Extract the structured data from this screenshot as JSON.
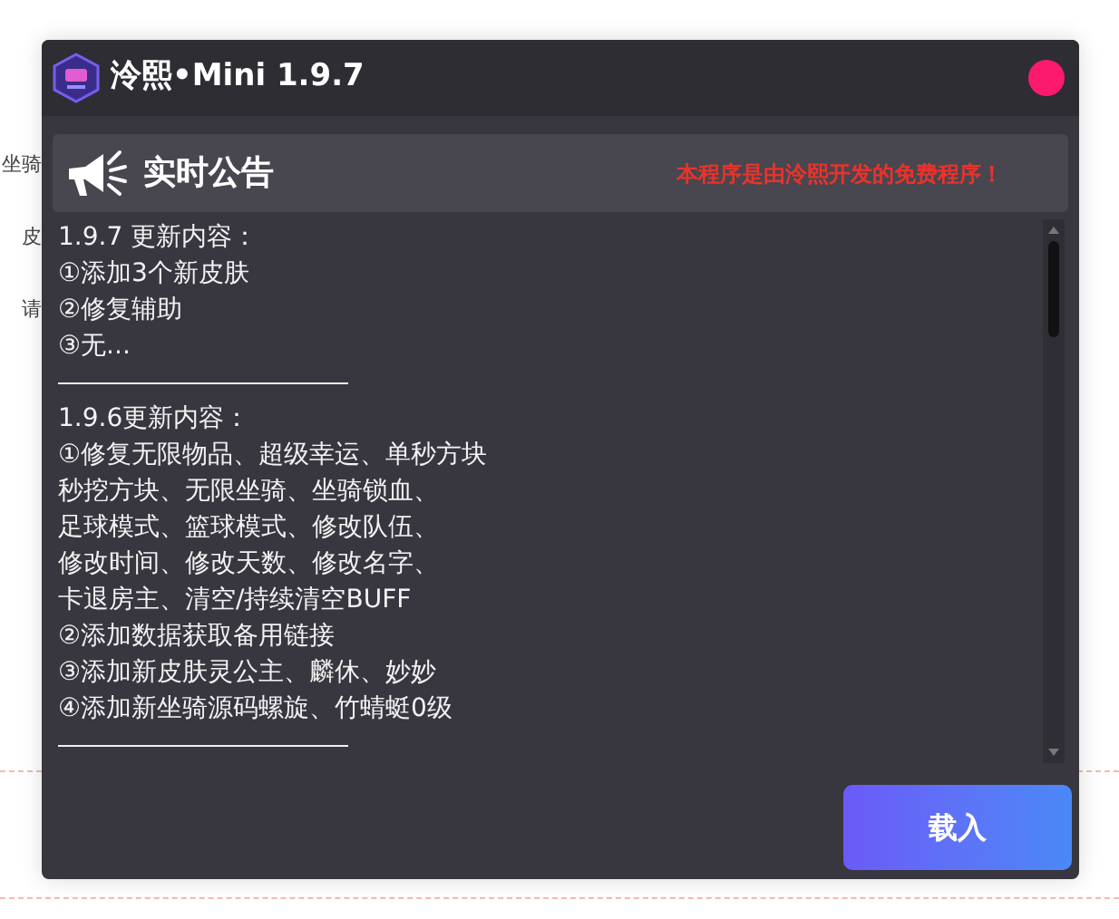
{
  "app": {
    "title": "泠熙•Mini 1.9.7"
  },
  "background_texts": [
    "坐骑",
    "皮",
    "请"
  ],
  "notice": {
    "heading": "实时公告",
    "tagline": "本程序是由泠熙开发的免费程序！"
  },
  "changelog": [
    {
      "kind": "heading",
      "text": "1.9.7 更新内容："
    },
    {
      "kind": "line",
      "text": "①添加3个新皮肤"
    },
    {
      "kind": "line",
      "text": "②修复辅助"
    },
    {
      "kind": "line",
      "text": "③无..."
    },
    {
      "kind": "rule"
    },
    {
      "kind": "heading",
      "text": "1.9.6更新内容："
    },
    {
      "kind": "line",
      "text": "①修复无限物品、超级幸运、单秒方块"
    },
    {
      "kind": "line",
      "text": "秒挖方块、无限坐骑、坐骑锁血、"
    },
    {
      "kind": "line",
      "text": "足球模式、篮球模式、修改队伍、"
    },
    {
      "kind": "line",
      "text": "修改时间、修改天数、修改名字、"
    },
    {
      "kind": "line",
      "text": "卡退房主、清空/持续清空BUFF"
    },
    {
      "kind": "line",
      "text": "②添加数据获取备用链接"
    },
    {
      "kind": "line",
      "text": "③添加新皮肤灵公主、麟休、妙妙"
    },
    {
      "kind": "line",
      "text": "④添加新坐骑源码螺旋、竹蜻蜓0级"
    },
    {
      "kind": "rule"
    }
  ],
  "load_button": "载入"
}
